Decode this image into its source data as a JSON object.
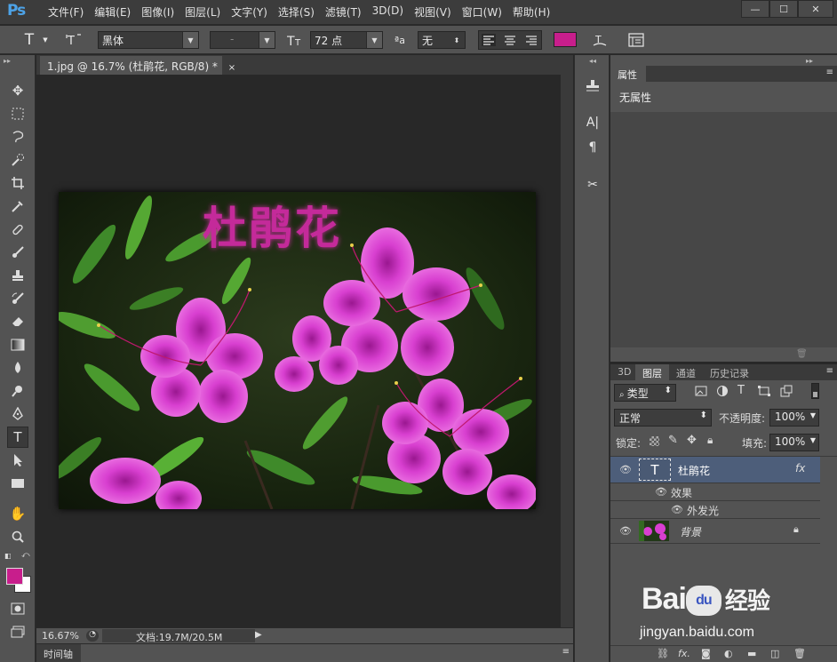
{
  "app": {
    "logo": "Ps",
    "menu": [
      "文件(F)",
      "编辑(E)",
      "图像(I)",
      "图层(L)",
      "文字(Y)",
      "选择(S)",
      "滤镜(T)",
      "3D(D)",
      "视图(V)",
      "窗口(W)",
      "帮助(H)"
    ],
    "window_buttons": [
      "—",
      "☐",
      "✕"
    ]
  },
  "options": {
    "tool_glyph": "T",
    "font_family": "黑体",
    "font_style": "-",
    "font_size": "72 点",
    "aa_label": "ªa",
    "antialias": "无",
    "text_color": "#c81e8c"
  },
  "document": {
    "tab_title": "1.jpg @ 16.7% (杜鹃花, RGB/8) *",
    "tab_close": "×",
    "overlay_text": "杜鹃花",
    "overlay_color": "#c42a9a"
  },
  "status": {
    "zoom": "16.67%",
    "doc_info": "文档:19.7M/20.5M"
  },
  "timeline": {
    "label": "时间轴"
  },
  "properties": {
    "tab": "属性",
    "empty_message": "无属性"
  },
  "layers": {
    "tabs": [
      "3D",
      "图层",
      "通道",
      "历史记录"
    ],
    "active_tab": "图层",
    "filter_kind": "类型",
    "blend_mode": "正常",
    "opacity_label": "不透明度:",
    "opacity_value": "100%",
    "lock_label": "锁定:",
    "fill_label": "填充:",
    "fill_value": "100%",
    "items": [
      {
        "name": "杜鹃花",
        "type": "text",
        "fx": "fx"
      },
      {
        "name": "效果",
        "type": "effect-group"
      },
      {
        "name": "外发光",
        "type": "effect"
      },
      {
        "name": "背景",
        "type": "image",
        "locked": true
      }
    ],
    "footer_icons": [
      "link-icon",
      "fx-icon",
      "mask-icon",
      "adjustment-icon",
      "folder-icon",
      "new-layer-icon",
      "trash-icon"
    ],
    "footer_fx": "fx."
  },
  "watermark": {
    "brand": "Bai",
    "brand_2": "du",
    "brand_3": "经验",
    "url": "jingyan.baidu.com"
  }
}
